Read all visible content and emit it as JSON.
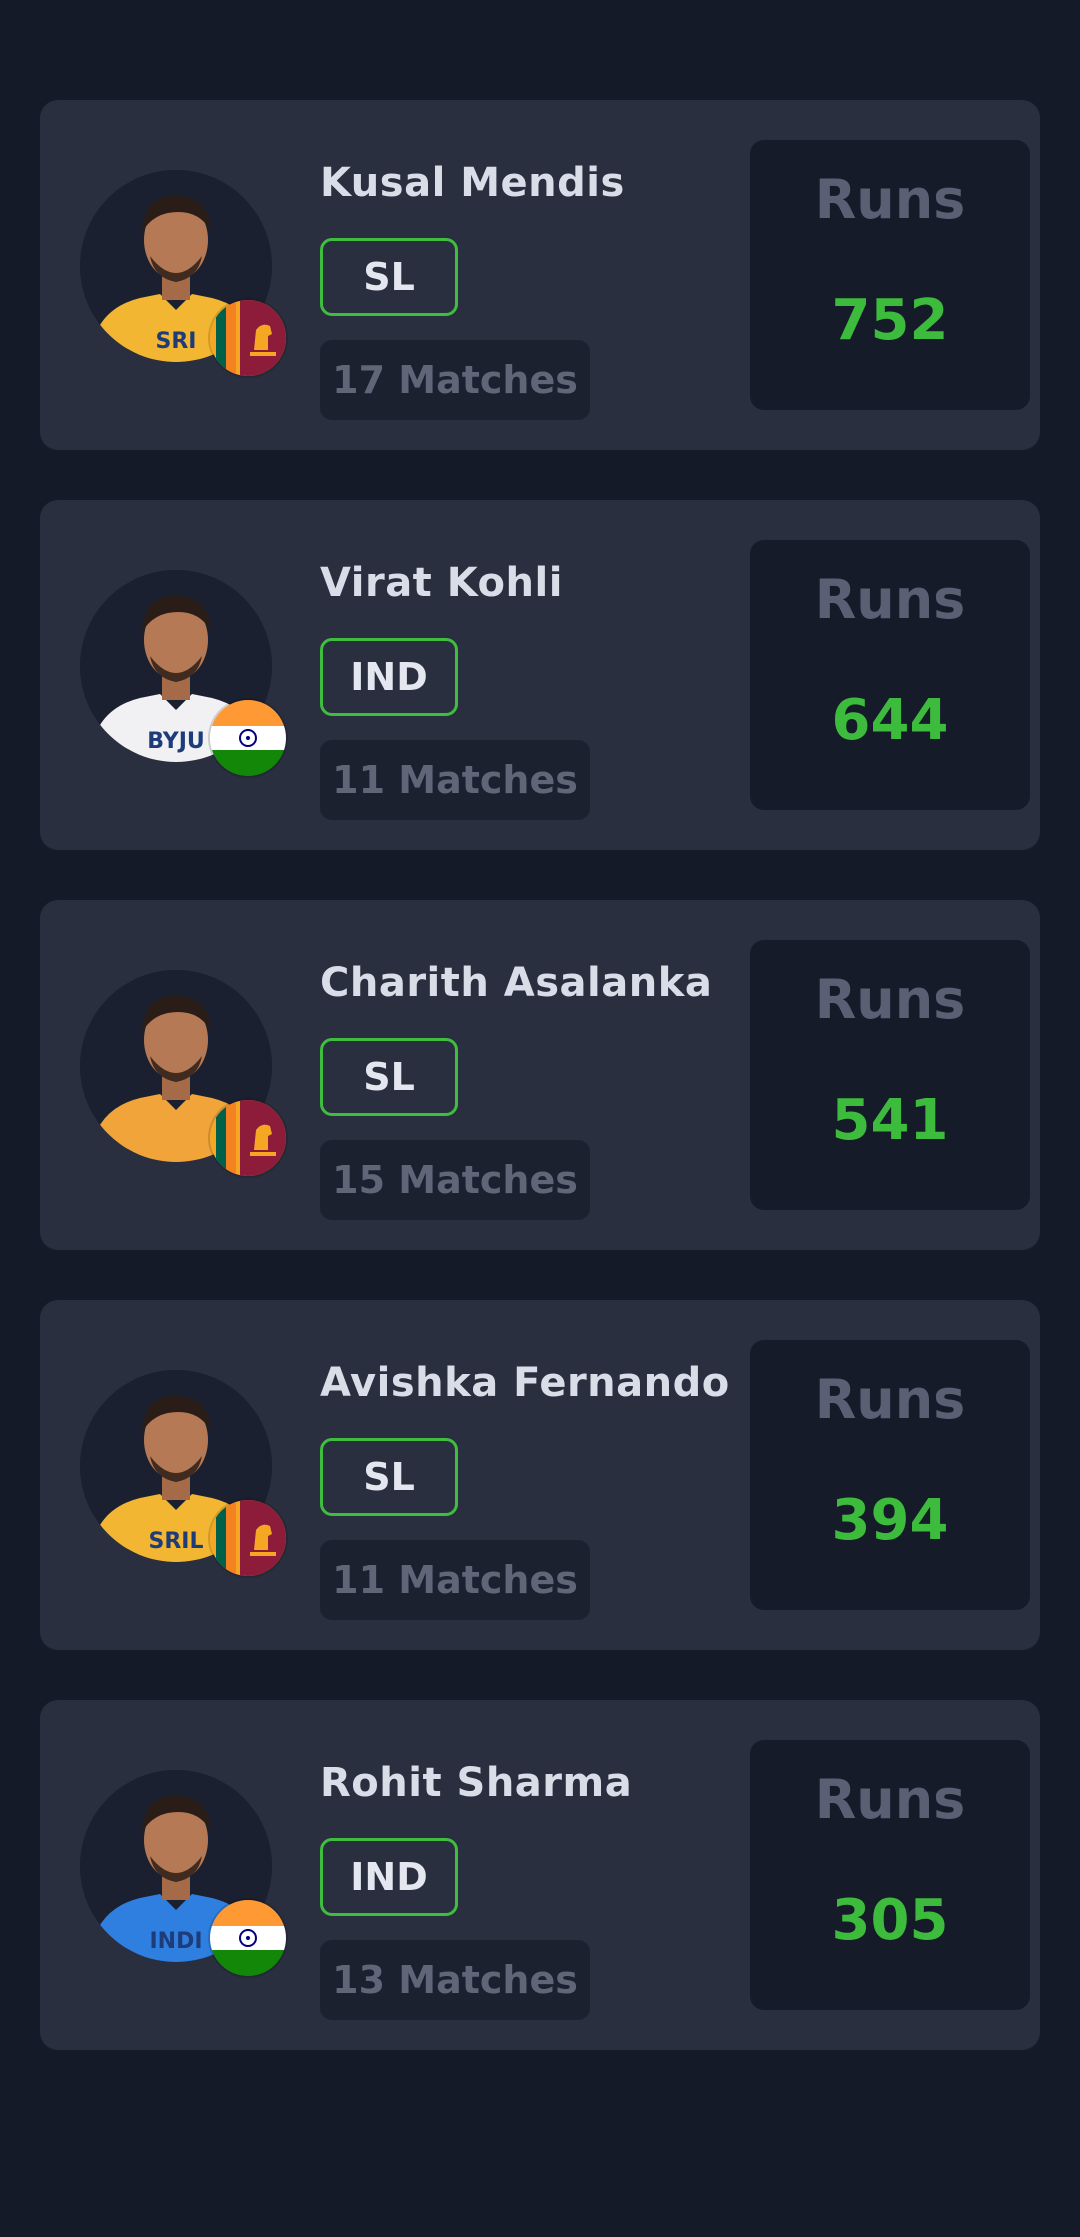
{
  "theme": {
    "background": "#151a28",
    "card": "#2a2f3f",
    "accent_green": "#3dbb3d",
    "muted_text": "#5a6073",
    "name_text": "#d9dde8"
  },
  "players": [
    {
      "name": "Kusal Mendis",
      "team": "SL",
      "matches": "17 Matches",
      "stat_label": "Runs",
      "stat_value": "752",
      "flag": "sri-lanka-flag-icon",
      "jersey": "#f2b632",
      "jersey_text": "SRI"
    },
    {
      "name": "Virat Kohli",
      "team": "IND",
      "matches": "11 Matches",
      "stat_label": "Runs",
      "stat_value": "644",
      "flag": "india-flag-icon",
      "jersey": "#f1f1f3",
      "jersey_text": "BYJU"
    },
    {
      "name": "Charith Asalanka",
      "team": "SL",
      "matches": "15 Matches",
      "stat_label": "Runs",
      "stat_value": "541",
      "flag": "sri-lanka-flag-icon",
      "jersey": "#f0a43a",
      "jersey_text": ""
    },
    {
      "name": "Avishka Fernando",
      "team": "SL",
      "matches": "11 Matches",
      "stat_label": "Runs",
      "stat_value": "394",
      "flag": "sri-lanka-flag-icon",
      "jersey": "#f2b632",
      "jersey_text": "SRIL"
    },
    {
      "name": "Rohit Sharma",
      "team": "IND",
      "matches": "13 Matches",
      "stat_label": "Runs",
      "stat_value": "305",
      "flag": "india-flag-icon",
      "jersey": "#2f7fe0",
      "jersey_text": "INDI"
    }
  ]
}
